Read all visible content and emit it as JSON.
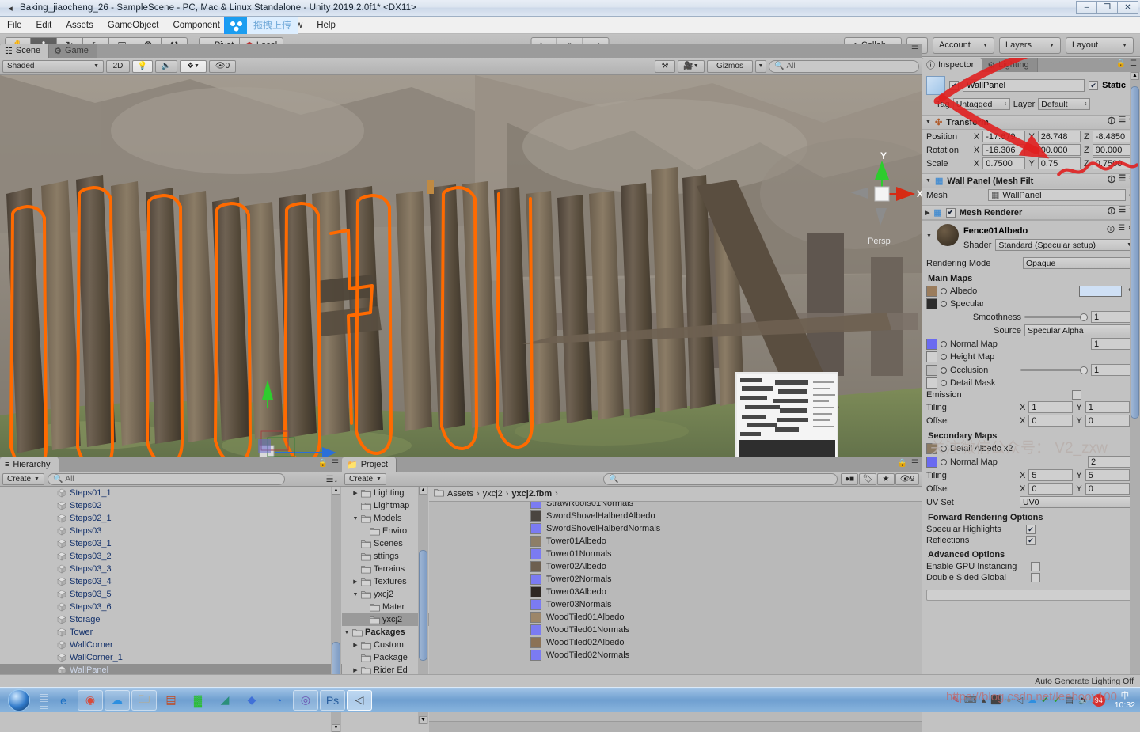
{
  "window": {
    "title": "Baking_jiaocheng_26 - SampleScene - PC, Mac & Linux Standalone - Unity 2019.2.0f1* <DX11>",
    "app_icon": "unity-icon",
    "minimize": "–",
    "maximize": "❐",
    "close": "✕"
  },
  "menu": {
    "items": [
      "File",
      "Edit",
      "Assets",
      "GameObject",
      "Component",
      "w",
      "Help"
    ],
    "plugin": {
      "icon": "baidu-netdisk-icon",
      "label": "拖拽上传"
    }
  },
  "toolbar": {
    "tools": [
      {
        "name": "hand-tool",
        "glyph": "✋"
      },
      {
        "name": "move-tool",
        "glyph": "✤"
      },
      {
        "name": "rotate-tool",
        "glyph": "↻"
      },
      {
        "name": "scale-tool",
        "glyph": "⤡"
      },
      {
        "name": "rect-tool",
        "glyph": "▣"
      },
      {
        "name": "transform-tool",
        "glyph": "❂"
      },
      {
        "name": "custom-tool",
        "glyph": "⚒"
      }
    ],
    "active_tool_index": 1,
    "pivot_label": "Pivot",
    "local_label": "Local",
    "play": "▶",
    "pause": "⏸",
    "step": "⏭",
    "collab_label": "Collab",
    "cloud_icon": "cloud-icon",
    "account_label": "Account",
    "layers_label": "Layers",
    "layout_label": "Layout"
  },
  "scene": {
    "tabs": [
      {
        "label": "Scene",
        "icon": "scene-icon",
        "active": true
      },
      {
        "label": "Game",
        "icon": "game-icon",
        "active": false
      }
    ],
    "draw_mode": "Shaded",
    "two_d": "2D",
    "lighting_icon": "light-bulb-icon",
    "audio_icon": "speaker-icon",
    "fx_icon": "effects-icon",
    "hidden_count": "0",
    "gizmos_label": "Gizmos",
    "search_placeholder": "All",
    "camera_icon": "camera-icon",
    "tools_icon": "wrench-icon",
    "axis_gizmo": {
      "y": "Y",
      "x": "X",
      "mode": "Persp"
    }
  },
  "hierarchy": {
    "tab_label": "Hierarchy",
    "tab_icon": "hierarchy-icon",
    "create_label": "Create",
    "search_placeholder": "All",
    "items": [
      {
        "label": "Steps01_1",
        "selected": false
      },
      {
        "label": "Steps02",
        "selected": false
      },
      {
        "label": "Steps02_1",
        "selected": false
      },
      {
        "label": "Steps03",
        "selected": false
      },
      {
        "label": "Steps03_1",
        "selected": false
      },
      {
        "label": "Steps03_2",
        "selected": false
      },
      {
        "label": "Steps03_3",
        "selected": false
      },
      {
        "label": "Steps03_4",
        "selected": false
      },
      {
        "label": "Steps03_5",
        "selected": false
      },
      {
        "label": "Steps03_6",
        "selected": false
      },
      {
        "label": "Storage",
        "selected": false
      },
      {
        "label": "Tower",
        "selected": false
      },
      {
        "label": "WallCorner",
        "selected": false
      },
      {
        "label": "WallCorner_1",
        "selected": false
      },
      {
        "label": "WallPanel",
        "selected": true
      }
    ]
  },
  "project": {
    "tab_label": "Project",
    "tab_icon": "folder-icon",
    "create_label": "Create",
    "search_placeholder": "",
    "filter_icons": [
      "asset-label-icon",
      "tag-icon",
      "favorite-icon",
      "hidden-icon"
    ],
    "hidden_count": "9",
    "breadcrumb": [
      "Assets",
      "yxcj2",
      "yxcj2.fbm"
    ],
    "tree": [
      {
        "label": "Lighting",
        "depth": 1,
        "arrow": "▶",
        "bold": false,
        "selected": false,
        "clipped": true
      },
      {
        "label": "Lightmap",
        "depth": 1,
        "arrow": "",
        "bold": false,
        "selected": false
      },
      {
        "label": "Models",
        "depth": 1,
        "arrow": "▼",
        "bold": false,
        "selected": false
      },
      {
        "label": "Enviro",
        "depth": 2,
        "arrow": "",
        "bold": false,
        "selected": false
      },
      {
        "label": "Scenes",
        "depth": 1,
        "arrow": "",
        "bold": false,
        "selected": false
      },
      {
        "label": "sttings",
        "depth": 1,
        "arrow": "",
        "bold": false,
        "selected": false
      },
      {
        "label": "Terrains",
        "depth": 1,
        "arrow": "",
        "bold": false,
        "selected": false
      },
      {
        "label": "Textures",
        "depth": 1,
        "arrow": "▶",
        "bold": false,
        "selected": false
      },
      {
        "label": "yxcj2",
        "depth": 1,
        "arrow": "▼",
        "bold": false,
        "selected": false
      },
      {
        "label": "Mater",
        "depth": 2,
        "arrow": "",
        "bold": false,
        "selected": false
      },
      {
        "label": "yxcj2",
        "depth": 2,
        "arrow": "",
        "bold": false,
        "selected": true
      },
      {
        "label": "Packages",
        "depth": 0,
        "arrow": "▼",
        "bold": true,
        "selected": false
      },
      {
        "label": "Custom",
        "depth": 1,
        "arrow": "▶",
        "bold": false,
        "selected": false
      },
      {
        "label": "Package",
        "depth": 1,
        "arrow": "",
        "bold": false,
        "selected": false
      },
      {
        "label": "Rider Ed",
        "depth": 1,
        "arrow": "▶",
        "bold": false,
        "selected": false
      }
    ],
    "files": [
      {
        "label": "StrawRoofs01Normals",
        "swatch": "#7b7bf2",
        "clipped": true
      },
      {
        "label": "SwordShovelHalberdAlbedo",
        "swatch": "#4a4540"
      },
      {
        "label": "SwordShovelHalberdNormals",
        "swatch": "#7b7bf2"
      },
      {
        "label": "Tower01Albedo",
        "swatch": "#8d7e68"
      },
      {
        "label": "Tower01Normals",
        "swatch": "#7b7bf2"
      },
      {
        "label": "Tower02Albedo",
        "swatch": "#6d5f50"
      },
      {
        "label": "Tower02Normals",
        "swatch": "#7b7bf2"
      },
      {
        "label": "Tower03Albedo",
        "swatch": "#2e2722"
      },
      {
        "label": "Tower03Normals",
        "swatch": "#7b7bf2"
      },
      {
        "label": "WoodTiled01Albedo",
        "swatch": "#9c8669"
      },
      {
        "label": "WoodTiled01Normals",
        "swatch": "#7b7bf2"
      },
      {
        "label": "WoodTiled02Albedo",
        "swatch": "#8b7256"
      },
      {
        "label": "WoodTiled02Normals",
        "swatch": "#7b7bf2"
      }
    ]
  },
  "inspector": {
    "tabs": [
      {
        "label": "Inspector",
        "icon": "info-icon",
        "active": true
      },
      {
        "label": "Lighting",
        "icon": "lighting-icon",
        "active": false
      }
    ],
    "lock_icon": "lock-icon",
    "menu_icon": "hamburger-icon",
    "object": {
      "enabled": true,
      "name": "WallPanel",
      "static_label": "Static",
      "static_checked": true,
      "tag_label": "Tag",
      "tag_value": "Untagged",
      "layer_label": "Layer",
      "layer_value": "Default"
    },
    "transform": {
      "title": "Transform",
      "icon": "transform-icon",
      "rows": [
        {
          "label": "Position",
          "x": "-17.679",
          "y": "26.748",
          "z": "-8.4850"
        },
        {
          "label": "Rotation",
          "x": "-16.306",
          "y": "90.000",
          "z": "90.000"
        },
        {
          "label": "Scale",
          "x": "0.7500",
          "y": "0.75",
          "z": "0.7500"
        }
      ]
    },
    "mesh_filter": {
      "title": "Wall Panel (Mesh Filt",
      "mesh_label": "Mesh",
      "mesh_value": "WallPanel"
    },
    "mesh_renderer": {
      "title": "Mesh Renderer",
      "enabled": true
    },
    "material": {
      "name": "Fence01Albedo",
      "shader_label": "Shader",
      "shader_value": "Standard (Specular setup)",
      "rendering_mode_label": "Rendering Mode",
      "rendering_mode_value": "Opaque",
      "main_maps_title": "Main Maps",
      "maps": [
        {
          "label": "Albedo",
          "swatch": "#9a7c5c",
          "type": "color",
          "color": "#cfe0f5"
        },
        {
          "label": "Specular",
          "swatch": "#2c2c2c",
          "type": "none"
        },
        {
          "label": "Smoothness",
          "type": "slider",
          "value": "1",
          "indent": true
        },
        {
          "label": "Source",
          "type": "dropdown",
          "value": "Specular Alpha",
          "indent": true
        },
        {
          "label": "Normal Map",
          "swatch": "#6a6af0",
          "type": "number",
          "value": "1"
        },
        {
          "label": "Height Map",
          "swatch": "#d0d0d0",
          "type": "none"
        },
        {
          "label": "Occlusion",
          "swatch": "#bdbdbd",
          "type": "slider",
          "value": "1"
        },
        {
          "label": "Detail Mask",
          "swatch": "#d0d0d0",
          "type": "none"
        },
        {
          "label": "Emission",
          "swatch": "",
          "type": "checkbox"
        }
      ],
      "tiling_label": "Tiling",
      "offset_label": "Offset",
      "main_tiling": {
        "x": "1",
        "y": "1"
      },
      "main_offset": {
        "x": "0",
        "y": "0"
      },
      "secondary_title": "Secondary Maps",
      "secondary_maps": [
        {
          "label": "Detail Albedo x2",
          "swatch": "#8b7a63"
        },
        {
          "label": "Normal Map",
          "swatch": "#6a6af0",
          "value": "2"
        }
      ],
      "secondary_tiling": {
        "x": "5",
        "y": "5"
      },
      "secondary_offset": {
        "x": "0",
        "y": "0"
      },
      "uv_set_label": "UV Set",
      "uv_set_value": "UV0",
      "forward_title": "Forward Rendering Options",
      "specular_highlights_label": "Specular Highlights",
      "specular_highlights_checked": true,
      "reflections_label": "Reflections",
      "reflections_checked": true,
      "advanced_title": "Advanced Options",
      "gpu_instancing_label": "Enable GPU Instancing",
      "gpu_instancing_checked": false,
      "double_sided_label": "Double Sided Global",
      "double_sided_checked": false
    },
    "axis_labels": {
      "x": "X",
      "y": "Y",
      "z": "Z"
    }
  },
  "statusbar": {
    "text": "Auto Generate Lighting Off"
  },
  "taskbar": {
    "start_icon": "windows-start-orb",
    "quicklaunch": [
      {
        "name": "internet-explorer-icon",
        "glyph": "e",
        "color": "#1a6fc4",
        "boxed": false
      },
      {
        "name": "google-chrome-icon",
        "glyph": "◉",
        "color": "#d84b3b",
        "boxed": true
      },
      {
        "name": "baidu-netdisk-icon",
        "glyph": "☁",
        "color": "#2d8fe0",
        "boxed": true
      },
      {
        "name": "file-explorer-icon",
        "glyph": "🗀",
        "color": "#e0a43a",
        "boxed": true
      },
      {
        "name": "winrar-icon",
        "glyph": "▤",
        "color": "#c04a22",
        "boxed": false
      },
      {
        "name": "qq-music-icon",
        "glyph": "▓",
        "color": "#23c023",
        "boxed": false
      },
      {
        "name": "app-green-icon",
        "glyph": "◢",
        "color": "#2b8f7a",
        "boxed": false
      },
      {
        "name": "app-blue-kite-icon",
        "glyph": "◆",
        "color": "#4070d8",
        "boxed": false
      },
      {
        "name": "app-swirl-icon",
        "glyph": "◔",
        "color": "#2c6fd0",
        "boxed": false
      },
      {
        "name": "app-purple-icon",
        "glyph": "◎",
        "color": "#6a4fb0",
        "boxed": true
      },
      {
        "name": "photoshop-icon",
        "glyph": "Ps",
        "color": "#2a5f9e",
        "boxed": true
      },
      {
        "name": "unity-editor-icon",
        "glyph": "◁",
        "color": "#3a3a3a",
        "boxed": true,
        "active": true
      }
    ],
    "tray": [
      {
        "name": "notepad-icon",
        "glyph": "✎",
        "color": "#cc3333"
      },
      {
        "name": "keyboard-icon",
        "glyph": "⌨",
        "color": "#555"
      },
      {
        "name": "show-hidden-icon",
        "glyph": "▴",
        "color": "#444"
      },
      {
        "name": "usb-drive-icon",
        "glyph": "⬛",
        "color": "#2e8b3a"
      },
      {
        "name": "disc-icon",
        "glyph": "●",
        "color": "#888"
      },
      {
        "name": "unity-hub-icon",
        "glyph": "◁",
        "color": "#555"
      },
      {
        "name": "netdisk-tray-icon",
        "glyph": "☁",
        "color": "#2d8fe0"
      },
      {
        "name": "usb-safe-remove-icon",
        "glyph": "✔",
        "color": "#2e8b3a"
      },
      {
        "name": "security-icon",
        "glyph": "✔",
        "color": "#2fa02f"
      },
      {
        "name": "network-icon",
        "glyph": "▤",
        "color": "#444"
      },
      {
        "name": "volume-icon",
        "glyph": "🔊",
        "color": "#444"
      },
      {
        "name": "update-badge-icon",
        "glyph": "94",
        "color": "#d63030"
      }
    ],
    "clock_time": "10:32",
    "clock_ime": "中"
  },
  "watermarks": {
    "wechat": "关注微信公众号：  V2_zxw",
    "csdn": "https://blog.csdn.net/leebooy100"
  }
}
